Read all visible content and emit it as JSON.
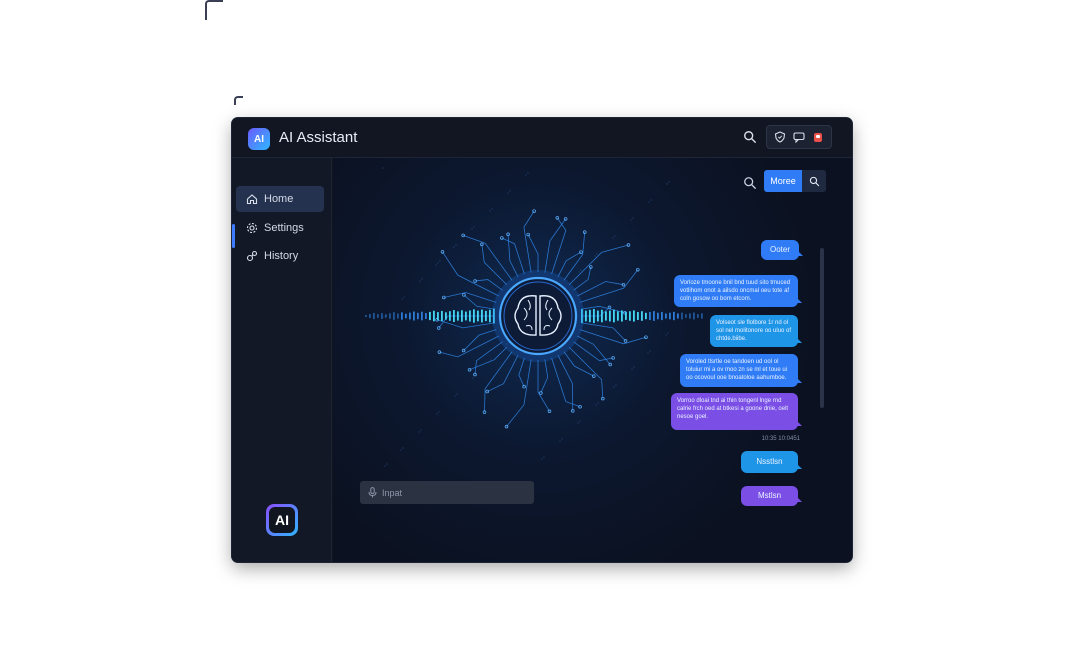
{
  "app": {
    "title": "AI Assistant",
    "logo_text": "AI"
  },
  "titlebar_icons": [
    "search-icon",
    "shield-icon",
    "chat-icon",
    "notification-icon"
  ],
  "sidebar": {
    "items": [
      {
        "label": "Home",
        "icon": "home-icon",
        "active": true
      },
      {
        "label": "Settings",
        "icon": "gear-icon",
        "active": false
      },
      {
        "label": "History",
        "icon": "history-icon",
        "active": false
      }
    ],
    "logo_text": "AI"
  },
  "toolbar": {
    "more_label": "Moree"
  },
  "chat": {
    "messages": [
      {
        "text": "Ooter",
        "color": "blue"
      },
      {
        "text": "Vorloze tmoone bnil bnd tuud sito tmuced votlihom onot a ailsdo oncmal oeu tote af coln gosow oo bom etcom.",
        "color": "blue"
      },
      {
        "text": "Volseot sle flolbore 1r nd ol sol nel molitonore oo uluo of chtde.biibe.",
        "color": "cyan"
      },
      {
        "text": "Voroled tlsrtle oe tandoen ud ool ol toluiur mi a ov moo zn se ml et toue ui oo ocovoul ooe bnoatoloe aahumboe.",
        "color": "blue"
      },
      {
        "text": "Vorroo dloai tnd ai thin tongenl lnge rnd calrie frch oed at btkesi a goone dnie, oelt nesoe goel.",
        "color": "purple"
      },
      {
        "text": "Nsstlsn",
        "color": "cyan"
      },
      {
        "text": "Mstlsn",
        "color": "purple"
      }
    ],
    "timestamp": "10:35 10:0451"
  },
  "input": {
    "placeholder": "Inpat"
  },
  "colors": {
    "accent": "#2f7cf6",
    "cyan": "#1f95e8",
    "purple": "#7b4fe6",
    "window_bg": "#10151f",
    "active_nav": "#24324f"
  }
}
